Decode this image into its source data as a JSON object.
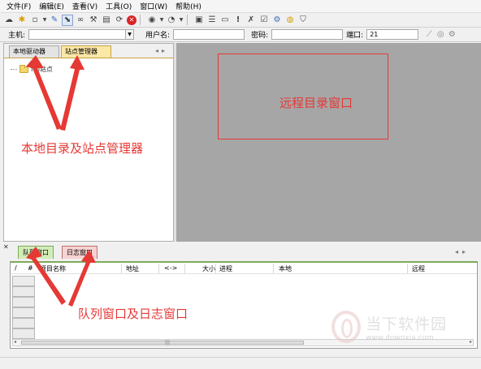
{
  "menu": {
    "items": [
      "文件(F)",
      "编辑(E)",
      "查看(V)",
      "工具(O)",
      "窗口(W)",
      "帮助(H)"
    ]
  },
  "toolbar": {
    "icons": [
      "connect-icon",
      "wand-icon",
      "new-icon",
      "dropdown-icon",
      "pencil-icon",
      "select-icon",
      "link-icon",
      "disconnect-icon",
      "cache-icon",
      "refresh-icon",
      "stop-icon",
      "play-icon",
      "dropdown-icon",
      "upload-icon",
      "dropdown-icon",
      "site-manager-icon",
      "list-icon",
      "folder-icon",
      "exclamation-icon",
      "delete-icon",
      "log-icon",
      "settings-icon",
      "support-icon",
      "shield-icon"
    ]
  },
  "connection": {
    "host_label": "主机:",
    "host_value": "",
    "user_label": "用户名:",
    "user_value": "",
    "password_label": "密码:",
    "password_value": "",
    "port_label": "端口:",
    "port_value": "21"
  },
  "left_panel": {
    "tabs": [
      "本地驱动器",
      "站点管理器"
    ],
    "selected_tab": "站点管理器",
    "tree": [
      "ftp站点"
    ]
  },
  "bottom_panel": {
    "tabs": [
      "队列窗口",
      "日志窗口"
    ],
    "columns": [
      "/",
      "#",
      "项目名称",
      "地址",
      "<->",
      "大小",
      "进程",
      "本地",
      "远程"
    ]
  },
  "annotations": {
    "local": "本地目录及站点管理器",
    "remote": "远程目录窗口",
    "queue": "队列窗口及日志窗口",
    "color": "#e53935"
  },
  "watermark": {
    "name": "当下软件园",
    "url": "www.downxia.com"
  }
}
